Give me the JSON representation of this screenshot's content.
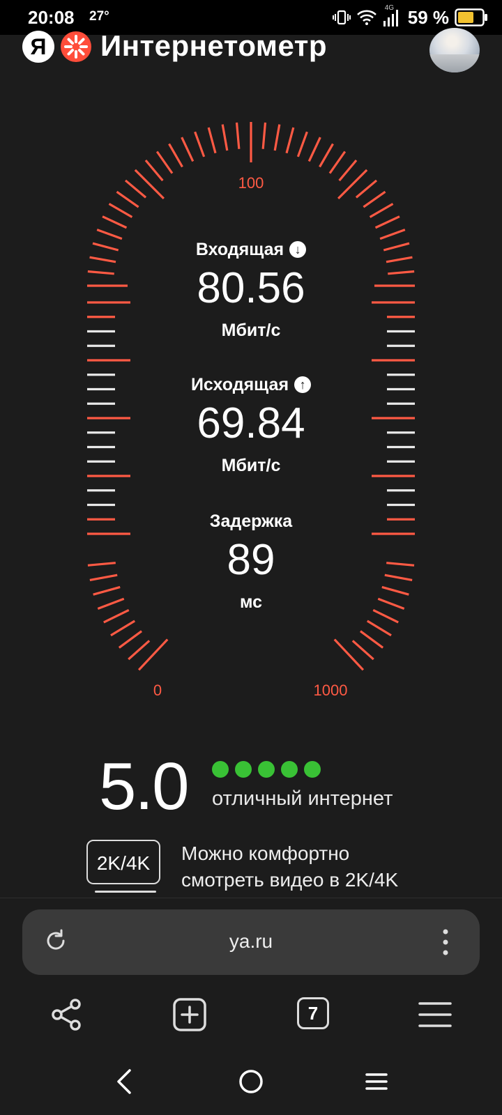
{
  "status_bar": {
    "time": "20:08",
    "temperature": "27°",
    "battery": "59 %",
    "network": "4G"
  },
  "header": {
    "logo_letter": "Я",
    "title": "Интернетометр"
  },
  "gauge": {
    "accent_color": "#ff5a44",
    "tick_labels": {
      "min": "0",
      "mid": "100",
      "max": "1000"
    }
  },
  "download": {
    "label": "Входящая",
    "value": "80.56",
    "unit": "Мбит/с",
    "icon": "arrow-down-icon"
  },
  "upload": {
    "label": "Исходящая",
    "value": "69.84",
    "unit": "Мбит/с",
    "icon": "arrow-up-icon"
  },
  "latency": {
    "label": "Задержка",
    "value": "89",
    "unit": "мс"
  },
  "rating": {
    "score": "5.0",
    "dots_filled": 5,
    "dots_total": 5,
    "dot_color": "#39c135",
    "text": "отличный интернет"
  },
  "resolution": {
    "badge": "2K/4K",
    "text_line1": "Можно комфортно",
    "text_line2": "смотреть видео в 2K/4K"
  },
  "address_bar": {
    "url": "ya.ru"
  },
  "toolbar": {
    "tab_count": "7",
    "icons": [
      "share-icon",
      "new-tab-icon",
      "tabs-icon",
      "menu-icon"
    ]
  },
  "nav_bar": {
    "icons": [
      "back-icon",
      "home-icon",
      "recents-icon"
    ]
  }
}
